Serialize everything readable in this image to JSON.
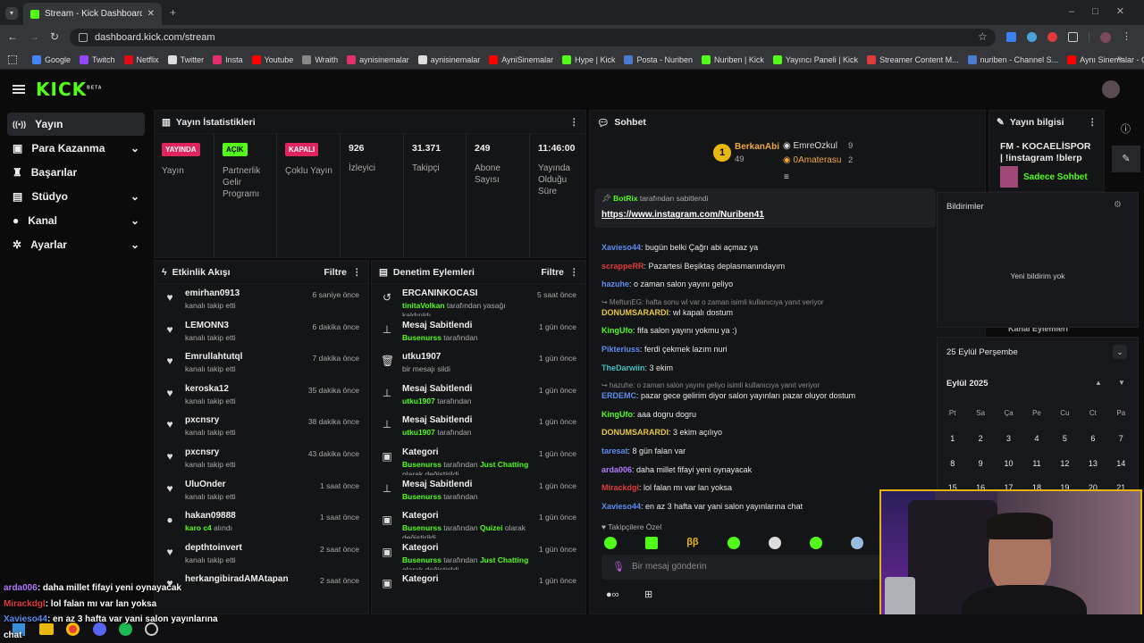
{
  "browser": {
    "tab_title": "Stream - Kick Dashboard",
    "url": "dashboard.kick.com/stream",
    "bookmarks": [
      "Google",
      "Twitch",
      "Netflix",
      "Twitter",
      "Insta",
      "Youtube",
      "Wraith",
      "aynisinemalar",
      "aynisinemalar",
      "AyniSinemalar",
      "Hype | Kick",
      "Posta - Nuriben",
      "Nuriben | Kick",
      "Yayıncı Paneli | Kick",
      "Streamer Content M...",
      "nuriben - Channel S...",
      "Aynı Sinemalar - Ça..."
    ]
  },
  "app": {
    "logo": "KICK",
    "logo_sup": "BETA"
  },
  "sidebar": {
    "items": [
      {
        "label": "Yayın"
      },
      {
        "label": "Para Kazanma"
      },
      {
        "label": "Başarılar"
      },
      {
        "label": "Stüdyo"
      },
      {
        "label": "Kanal"
      },
      {
        "label": "Ayarlar"
      }
    ]
  },
  "stats": {
    "title": "Yayın İstatistikleri",
    "badges": [
      {
        "text": "YAYINDA",
        "label": "Yayın"
      },
      {
        "text": "AÇIK",
        "label": "Partnerlik Gelir Programı"
      },
      {
        "text": "KAPALI",
        "label": "Çoklu Yayın"
      }
    ],
    "values": [
      {
        "value": "926",
        "label": "İzleyici"
      },
      {
        "value": "31.371",
        "label": "Takipçi"
      },
      {
        "value": "249",
        "label": "Abone Sayısı"
      },
      {
        "value": "11:46:00",
        "label": "Yayında Olduğu Süre"
      }
    ]
  },
  "activity": {
    "title": "Etkinlik Akışı",
    "filter": "Filtre",
    "items": [
      {
        "name": "emirhan0913",
        "sub": "kanalı takip etti",
        "time": "6 saniye önce"
      },
      {
        "name": "LEMONN3",
        "sub": "kanalı takip etti",
        "time": "6 dakika önce"
      },
      {
        "name": "Emrullahtutql",
        "sub": "kanalı takip etti",
        "time": "7 dakika önce"
      },
      {
        "name": "keroska12",
        "sub": "kanalı takip etti",
        "time": "35 dakika önce"
      },
      {
        "name": "pxcnsry",
        "sub": "kanalı takip etti",
        "time": "38 dakika önce"
      },
      {
        "name": "pxcnsry",
        "sub": "kanalı takip etti",
        "time": "43 dakika önce"
      },
      {
        "name": "UluOnder",
        "sub": "kanalı takip etti",
        "time": "1 saat önce"
      },
      {
        "name": "hakan09888",
        "sub_hl": "karo c4",
        "sub": " alındı",
        "time": "1 saat önce"
      },
      {
        "name": "depthtoinvert",
        "sub": "kanalı takip etti",
        "time": "2 saat önce"
      },
      {
        "name": "herkangibiradAMAtapan",
        "sub": "",
        "time": "2 saat önce"
      }
    ]
  },
  "moderation": {
    "title": "Denetim Eylemleri",
    "filter": "Filtre",
    "items": [
      {
        "name": "ERCANINKOCASI",
        "hl": "tinitaVolkan",
        "rest": " tarafından yasağı kaldırıldı",
        "time": "5 saat önce"
      },
      {
        "name": "Mesaj Sabitlendi",
        "hl": "Busenurss",
        "rest": " tarafından",
        "time": "1 gün önce"
      },
      {
        "name": "utku1907",
        "hl": "",
        "rest": "bir mesajı sildi",
        "time": "1 gün önce"
      },
      {
        "name": "Mesaj Sabitlendi",
        "hl": "utku1907",
        "rest": " tarafından",
        "time": "1 gün önce"
      },
      {
        "name": "Mesaj Sabitlendi",
        "hl": "utku1907",
        "rest": " tarafından",
        "time": "1 gün önce"
      },
      {
        "name": "Kategori",
        "hl": "Busenurss",
        "rest": " tarafından ",
        "hl2": "Just Chatting",
        "rest2": " olarak değiştirildi",
        "time": "1 gün önce"
      },
      {
        "name": "Mesaj Sabitlendi",
        "hl": "Busenurss",
        "rest": " tarafından",
        "time": "1 gün önce"
      },
      {
        "name": "Kategori",
        "hl": "Busenurss",
        "rest": " tarafından ",
        "hl2": "Quizei",
        "rest2": " olarak değiştirildi",
        "time": "1 gün önce"
      },
      {
        "name": "Kategori",
        "hl": "Busenurss",
        "rest": " tarafından ",
        "hl2": "Just Chatting",
        "rest2": " olarak değiştirildi",
        "time": "1 gün önce"
      },
      {
        "name": "Kategori",
        "hl": "",
        "rest": "",
        "time": "1 gün önce"
      }
    ]
  },
  "chat": {
    "title": "Sohbet",
    "leaders": {
      "first_name": "BerkanAbi",
      "first_count": "49",
      "second_name": "EmreOzkul",
      "second_count": "9",
      "third_name": "0Amaterasu",
      "third_count": "2"
    },
    "pinned": {
      "by": "BotRix",
      "by_suffix": "tarafından sabitlendi",
      "link": "https://www.instagram.com/Nuriben41"
    },
    "messages": [
      {
        "user": "Xavieso44",
        "color": "#5b8def",
        "text": ": bugün belki Çağrı abi açmaz ya"
      },
      {
        "user": "scrappeRR",
        "color": "#e03b3b",
        "text": ": Pazartesi Beşiktaş deplasmanındayım"
      },
      {
        "user": "hazuhe",
        "color": "#5b8def",
        "text": ": o zaman salon yayını geliyo"
      },
      {
        "reply": "MeftunEG: hafta sonu wl var o zaman isimli kullanıcıya yanıt veriyor",
        "user": "DONUMSARARDI",
        "color": "#e8c73a",
        "text": ": wl kapalı dostum"
      },
      {
        "user": "KingUfo",
        "color": "#53fc18",
        "text": ": fifa salon yayını yokmu ya :)"
      },
      {
        "user": "Pikteriuss",
        "color": "#5b8def",
        "text": ": ferdi çekmek lazım nuri"
      },
      {
        "user": "TheDarwiin",
        "color": "#40c0c0",
        "text": ": 3 ekim"
      },
      {
        "reply": "hazuhe: o zaman salon yayını geliyo isimli kullanıcıya yanıt veriyor",
        "user": "ERDEMC",
        "color": "#5b8def",
        "text": ": pazar gece gelirim diyor salon yayınları pazar oluyor dostum"
      },
      {
        "user": "KingUfo",
        "color": "#53fc18",
        "text": ": aaa dogru dogru"
      },
      {
        "user": "DONUMSARARDI",
        "color": "#e8c73a",
        "text": ": 3 ekim açılıyo"
      },
      {
        "user": "taresat",
        "color": "#5b8def",
        "text": ": 8 gün falan var"
      },
      {
        "user": "arda006",
        "color": "#b37bff",
        "text": ": daha millet fifayi yeni oynayacak"
      },
      {
        "user": "Mirackdgl",
        "color": "#e03b3b",
        "text": ": lol falan mı var lan yoksa"
      },
      {
        "user": "Xavieso44",
        "color": "#5b8def",
        "text": ": en az 3 hafta var yani salon yayınlarına chat"
      }
    ],
    "emote_label": "Takipçilere Özel",
    "input_placeholder": "Bir mesaj gönderin"
  },
  "stream_info": {
    "title": "Yayın bilgisi",
    "stream_title": "FM - KOCAELİSPOR | !instagram !blerp",
    "category": "Sadece Sohbet",
    "partial": "Kanal Eylemleri"
  },
  "notifications": {
    "title": "Bildirimler",
    "empty": "Yeni bildirim yok"
  },
  "calendar": {
    "date": "25 Eylül Perşembe",
    "month": "Eylül 2025",
    "days": [
      "Pt",
      "Sa",
      "Ça",
      "Pe",
      "Cu",
      "Ct",
      "Pa"
    ],
    "row1": [
      "1",
      "2",
      "3",
      "4",
      "5",
      "6",
      "7"
    ],
    "row2": [
      "8",
      "9",
      "10",
      "11",
      "12",
      "13",
      "14"
    ],
    "row3": [
      "15",
      "16",
      "17",
      "18",
      "19",
      "20",
      "21"
    ]
  },
  "overlay_chat": [
    {
      "user": "arda006",
      "color": "#b37bff",
      "text": ": daha millet fifayi yeni oynayacak"
    },
    {
      "user": "Mirackdgl",
      "color": "#e03b3b",
      "text": ": lol falan mı var lan yoksa"
    },
    {
      "user": "Xavieso44",
      "color": "#5b8def",
      "text": ": en az 3 hafta var yani salon yayınlarına"
    },
    {
      "user": "",
      "color": "#fff",
      "text": "chat"
    }
  ]
}
